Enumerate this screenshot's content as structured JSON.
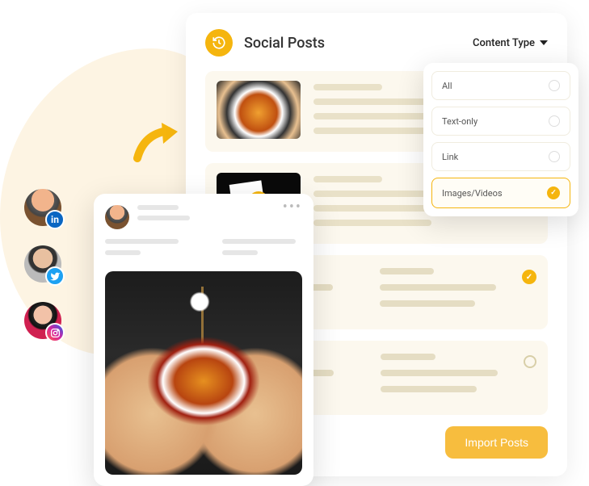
{
  "panel": {
    "title": "Social Posts",
    "content_type_label": "Content Type",
    "import_label": "Import Posts"
  },
  "dropdown": {
    "options": [
      {
        "label": "All",
        "selected": false
      },
      {
        "label": "Text-only",
        "selected": false
      },
      {
        "label": "Link",
        "selected": false
      },
      {
        "label": "Images/Videos",
        "selected": true
      }
    ]
  },
  "avatars": {
    "linkedin": "in",
    "instagram": "⌂"
  }
}
